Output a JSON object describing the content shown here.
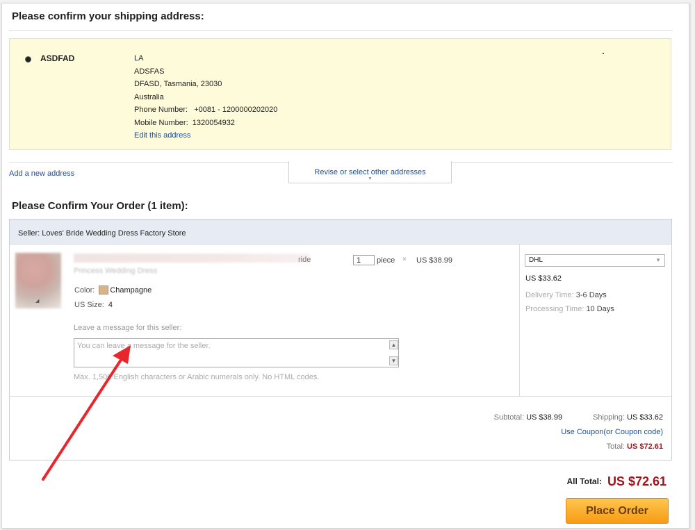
{
  "shipping": {
    "title": "Please confirm your shipping address:",
    "recipient_name": "ASDFAD",
    "address_lines": [
      "LA",
      "ADSFAS",
      "DFASD, Tasmania, 23030",
      "Australia",
      "Phone Number:   +0081 - 1200000202020",
      "Mobile Number:  1320054932"
    ],
    "edit_link": "Edit this address",
    "add_new_link": "Add a new address",
    "revise_link": "Revise or select other addresses"
  },
  "order": {
    "title": "Please Confirm Your Order (1 item):",
    "seller": "Seller: Loves' Bride Wedding Dress Factory Store",
    "item": {
      "title_end": "ride",
      "subtitle": "Princess Wedding Dress",
      "color_label": "Color:",
      "color_value": "Champagne",
      "color_hex": "#d6b38a",
      "size_label": "US Size:",
      "size_value": "4",
      "quantity": "1",
      "unit": "piece",
      "times": "×",
      "unit_price": "US $38.99"
    },
    "message": {
      "label": "Leave a message for this seller:",
      "placeholder": "You can leave a message for the seller.",
      "hint": "Max. 1,500 English characters or Arabic numerals only. No HTML codes."
    },
    "shipping_method": {
      "selected": "DHL",
      "price": "US $33.62",
      "delivery_label": "Delivery Time:",
      "delivery_value": "3-6 Days",
      "processing_label": "Processing Time:",
      "processing_value": "10 Days"
    },
    "summary": {
      "subtotal_label": "Subtotal:",
      "subtotal_value": "US $38.99",
      "shipping_label": "Shipping:",
      "shipping_value": "US $33.62",
      "coupon_link": "Use Coupon(or Coupon code)",
      "total_label": "Total:",
      "total_value": "US $72.61"
    }
  },
  "checkout": {
    "all_total_label": "All Total:",
    "all_total_value": "US $72.61",
    "place_order_label": "Place Order"
  },
  "colors": {
    "address_bg": "#fdfbd9",
    "seller_bar_bg": "#e6ebf4",
    "link": "#1d4ea0",
    "total_red": "#a80f18",
    "button_orange": "#f79b15",
    "annotation_arrow": "#e8262b"
  }
}
